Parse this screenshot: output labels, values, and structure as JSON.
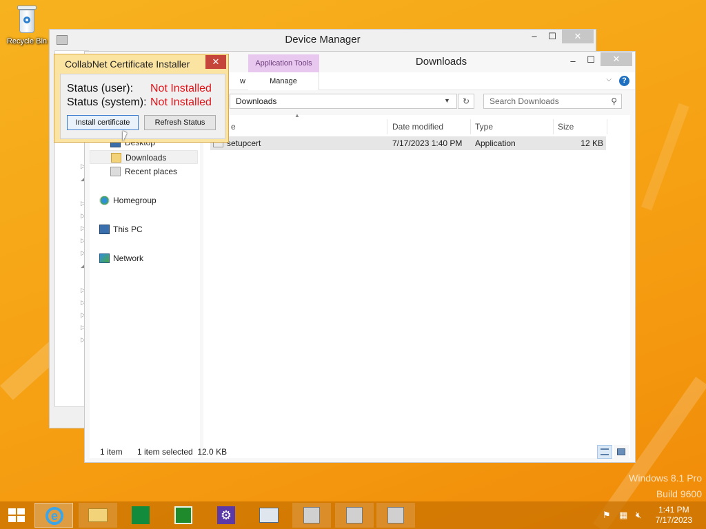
{
  "desktop": {
    "recycle_bin_label": "Recycle Bin",
    "watermark_line1": "Windows 8.1 Pro",
    "watermark_line2": "Build 9600"
  },
  "device_manager": {
    "title": "Device Manager",
    "minimize": "–",
    "maximize": "☐",
    "close": "✕"
  },
  "explorer": {
    "title": "Downloads",
    "minimize": "–",
    "maximize": "☐",
    "close": "✕",
    "ribbon": {
      "contextual_group": "Application Tools",
      "view_tab": "w",
      "manage_tab": "Manage"
    },
    "address_path": "Downloads",
    "search_placeholder": "Search Downloads",
    "nav": {
      "desktop": "Desktop",
      "downloads": "Downloads",
      "recent": "Recent places",
      "homegroup": "Homegroup",
      "this_pc": "This PC",
      "network": "Network"
    },
    "columns": {
      "name": "e",
      "date": "Date modified",
      "type": "Type",
      "size": "Size"
    },
    "files": [
      {
        "name": "setupcert",
        "date": "7/17/2023 1:40 PM",
        "type": "Application",
        "size": "12 KB"
      }
    ],
    "status": {
      "count": "1 item",
      "selection": "1 item selected  12.0 KB"
    }
  },
  "collabnet": {
    "title": "CollabNet Certificate Installer",
    "close": "✕",
    "status_user_label": "Status (user):",
    "status_user_value": "Not Installed",
    "status_system_label": "Status (system):",
    "status_system_value": "Not Installed",
    "install_button": "Install certificate",
    "refresh_button": "Refresh Status"
  },
  "taskbar": {
    "time": "1:41 PM",
    "date": "7/17/2023"
  },
  "colors": {
    "accent_orange": "#f6a516",
    "status_red": "#e1141a",
    "app_tools_purple": "#e9c8ef",
    "dialog_yellow": "#fbe3a2"
  }
}
